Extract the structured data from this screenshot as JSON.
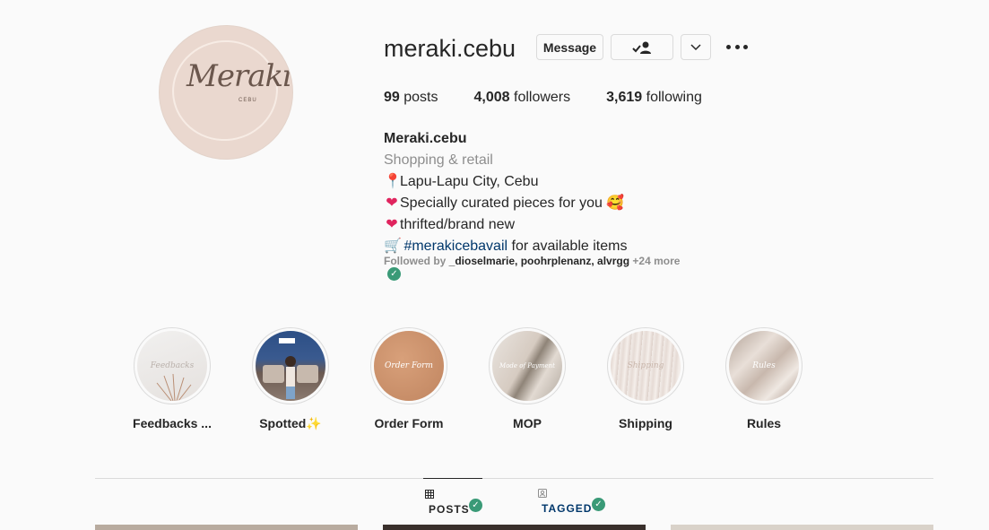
{
  "profile": {
    "username": "meraki.cebu",
    "avatar_logo": "Meraki",
    "avatar_sub": "CEBU"
  },
  "actions": {
    "message_label": "Message",
    "following_icon": "person-check-icon",
    "dropdown_icon": "chevron-down-icon",
    "more_icon": "more-options-icon"
  },
  "stats": {
    "posts": {
      "count": "99",
      "label": "posts"
    },
    "followers": {
      "count": "4,008",
      "label": "followers"
    },
    "following": {
      "count": "3,619",
      "label": "following"
    }
  },
  "bio": {
    "name": "Meraki.cebu",
    "category": "Shopping & retail",
    "line1": "Lapu-Lapu City, Cebu",
    "line2": "Specially curated pieces for you",
    "line3": "thrifted/brand new",
    "hashtag": "#merakicebavail",
    "line4_rest": " for available items"
  },
  "followed_by": {
    "prefix": "Followed by ",
    "users": "_dioselmarie, poohrplenanz, alvrgg",
    "more": " +24 more"
  },
  "highlights": [
    {
      "label": "Feedbacks ...",
      "cover_text": "Feedbacks"
    },
    {
      "label": "Spotted✨",
      "cover_text": ""
    },
    {
      "label": "Order Form",
      "cover_text": "Order Form"
    },
    {
      "label": "MOP",
      "cover_text": "Mode of Payment"
    },
    {
      "label": "Shipping",
      "cover_text": "Shipping"
    },
    {
      "label": "Rules",
      "cover_text": "Rules"
    }
  ],
  "tabs": {
    "posts": "POSTS",
    "tagged": "TAGGED"
  },
  "colors": {
    "accent_link": "#00376b",
    "check": "#3a9a77",
    "avatar_bg": "#ead8cf"
  }
}
